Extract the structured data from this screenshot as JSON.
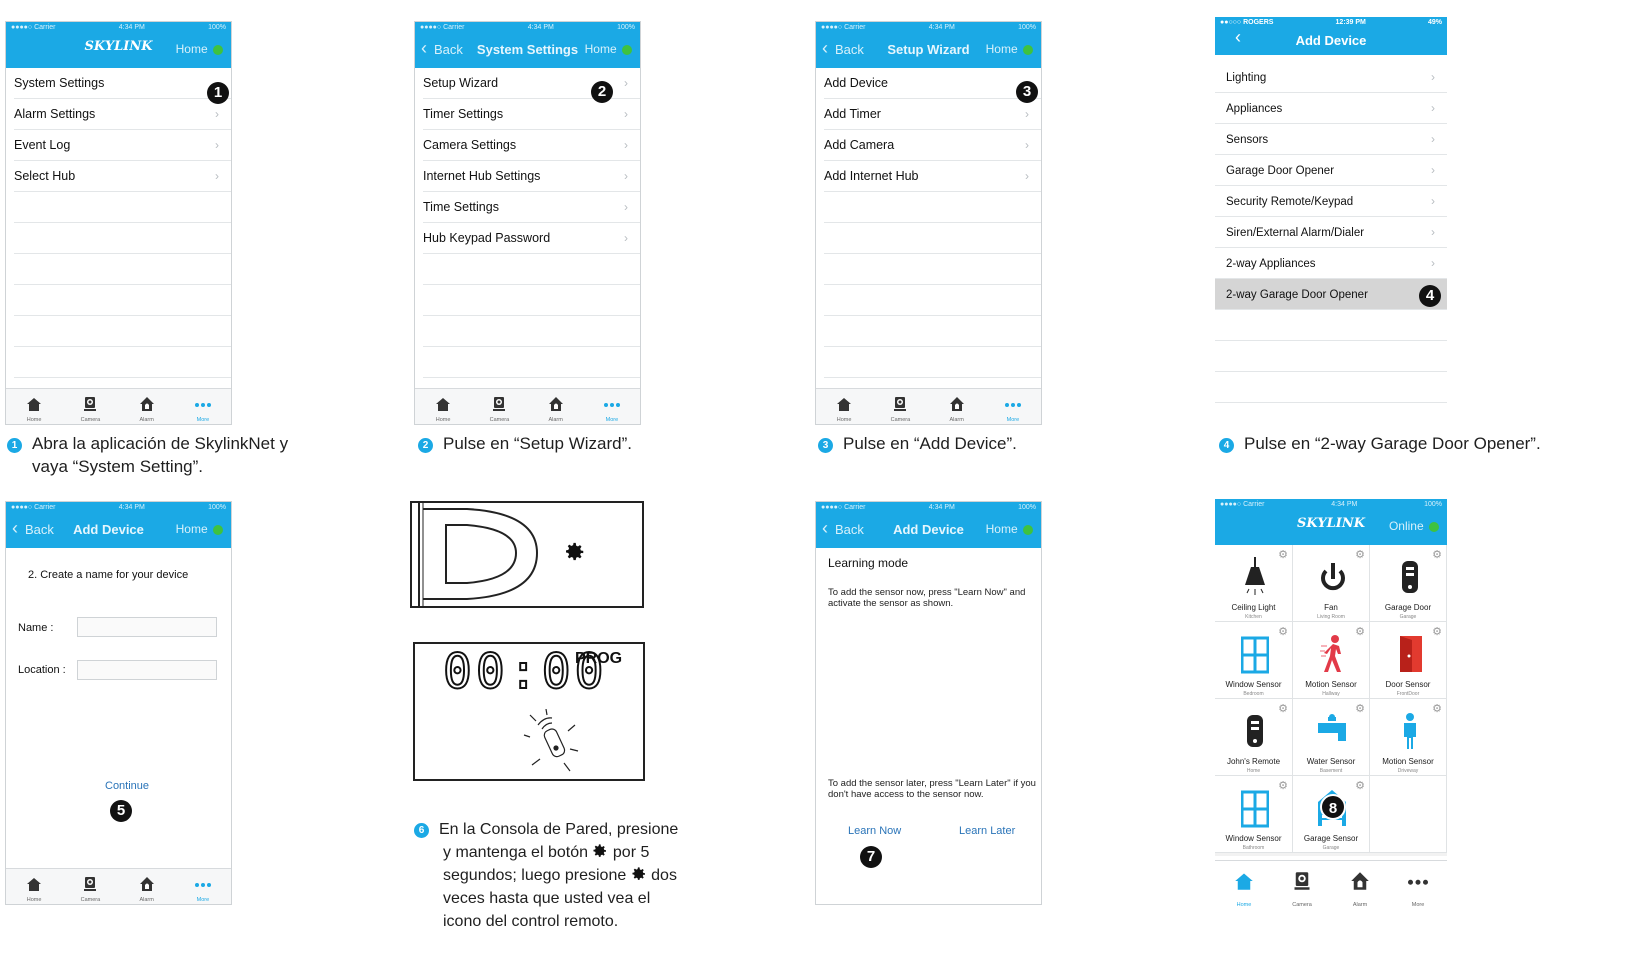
{
  "colors": {
    "accent": "#1ba9e5",
    "online": "#3fc23f",
    "link": "#2a74b8"
  },
  "status": {
    "carrier": "●●●●○ Carrier",
    "time": "4:34 PM",
    "battery": "100%"
  },
  "status_rogers": {
    "carrier": "●●○○○ ROGERS",
    "time": "12:39 PM",
    "battery": "49%"
  },
  "common": {
    "home": "Home",
    "back": "Back",
    "online": "Online"
  },
  "tabs": {
    "home": "Home",
    "camera": "Camera",
    "alarm": "Alarm",
    "more": "More"
  },
  "logo": "SKYLINK",
  "screen1": {
    "items": [
      "System Settings",
      "Alarm Settings",
      "Event Log",
      "Select Hub"
    ],
    "badge": "1"
  },
  "screen2": {
    "title": "System Settings",
    "items": [
      "Setup Wizard",
      "Timer Settings",
      "Camera Settings",
      "Internet Hub Settings",
      "Time Settings",
      "Hub Keypad Password"
    ],
    "badge": "2"
  },
  "screen3": {
    "title": "Setup Wizard",
    "items": [
      "Add Device",
      "Add Timer",
      "Add Camera",
      "Add Internet Hub"
    ],
    "badge": "3"
  },
  "screen4": {
    "title": "Add Device",
    "items": [
      "Lighting",
      "Appliances",
      "Sensors",
      "Garage Door Opener",
      "Security Remote/Keypad",
      "Siren/External Alarm/Dialer",
      "2-way Appliances",
      "2-way Garage Door Opener"
    ],
    "badge": "4"
  },
  "screen5": {
    "title": "Add Device",
    "heading": "2. Create a name for your device",
    "name_label": "Name :",
    "location_label": "Location :",
    "continue": "Continue",
    "badge": "5"
  },
  "screen6": {
    "lcd_text": "00:00",
    "prog": "PROG"
  },
  "screen7": {
    "title": "Add Device",
    "heading": "Learning mode",
    "text1": "To add the sensor now, press \"Learn Now\" and activate the sensor as shown.",
    "text2": "To add the sensor later, press \"Learn Later\" if you don't have access to the sensor now.",
    "learn_now": "Learn Now",
    "learn_later": "Learn Later",
    "badge": "7"
  },
  "screen8": {
    "badge": "8",
    "tiles": [
      {
        "name": "Ceiling Light",
        "location": "Kitchen",
        "icon": "ceiling-light-icon"
      },
      {
        "name": "Fan",
        "location": "Living Room",
        "icon": "power-icon"
      },
      {
        "name": "Garage Door",
        "location": "Garage",
        "icon": "remote-icon"
      },
      {
        "name": "Window Sensor",
        "location": "Bedroom",
        "icon": "window-icon"
      },
      {
        "name": "Motion Sensor",
        "location": "Hallway",
        "icon": "walking-person-icon"
      },
      {
        "name": "Door Sensor",
        "location": "FrontDoor",
        "icon": "door-icon"
      },
      {
        "name": "John's Remote",
        "location": "Home",
        "icon": "remote-icon"
      },
      {
        "name": "Water Sensor",
        "location": "Basement",
        "icon": "faucet-icon"
      },
      {
        "name": "Motion Sensor",
        "location": "Driveway",
        "icon": "person-icon"
      },
      {
        "name": "Window Sensor",
        "location": "Bathroom",
        "icon": "window-icon"
      },
      {
        "name": "Garage Sensor",
        "location": "Garage",
        "icon": "garage-icon"
      }
    ]
  },
  "captions": {
    "c1_num": "1",
    "c1_line1": "Abra la aplicación de SkylinkNet y",
    "c1_line2": "vaya “System Setting”.",
    "c2_num": "2",
    "c2": "Pulse en “Setup Wizard”.",
    "c3_num": "3",
    "c3": "Pulse en “Add Device”.",
    "c4_num": "4",
    "c4": "Pulse en “2-way Garage Door Opener”.",
    "c6_num": "6",
    "c6_line1": "En la Consola de Pared, presione",
    "c6_line2a": "y mantenga el botón",
    "c6_line2b": "por 5",
    "c6_line3a": "segundos; luego presione",
    "c6_line3b": "dos",
    "c6_line4": "veces hasta que usted vea el",
    "c6_line5": "icono del control remoto."
  }
}
